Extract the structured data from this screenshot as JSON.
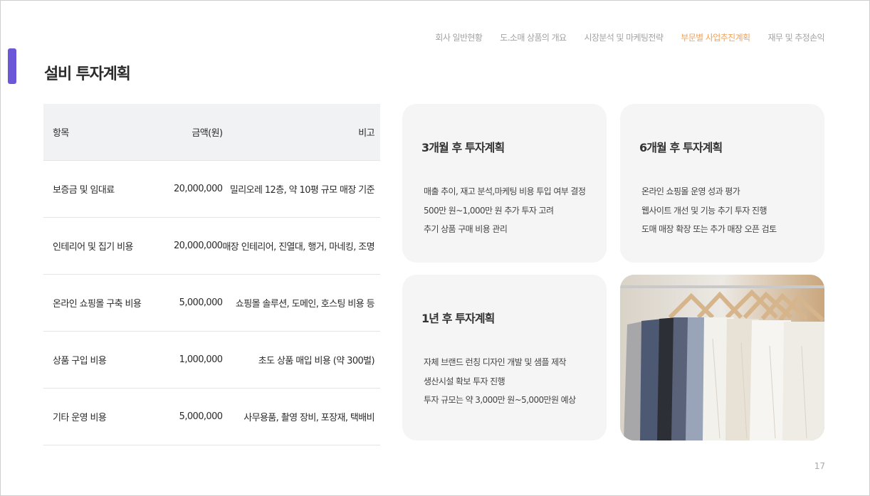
{
  "nav": {
    "items": [
      {
        "label": "회사 일반현황",
        "active": false
      },
      {
        "label": "도.소매 상품의 개요",
        "active": false
      },
      {
        "label": "시장분석 및 마케팅전략",
        "active": false
      },
      {
        "label": "부문별 사업추진계획",
        "active": true
      },
      {
        "label": "재무 및 추정손익",
        "active": false
      }
    ]
  },
  "page": {
    "title": "설비 투자계획",
    "number": "17"
  },
  "table": {
    "headers": [
      "항목",
      "금액(원)",
      "비고"
    ],
    "rows": [
      [
        "보증금 및 임대료",
        "20,000,000",
        "밀리오레 12층, 약 10평 규모 매장 기준"
      ],
      [
        "인테리어 및 집기 비용",
        "20,000,000",
        "매장 인테리어, 진열대, 행거, 마네킹, 조명"
      ],
      [
        "온라인 쇼핑몰 구축 비용",
        "5,000,000",
        "쇼핑몰 솔루션, 도메인, 호스팅 비용 등"
      ],
      [
        "상품 구입 비용",
        "1,000,000",
        "초도 상품 매입 비용 (약 300벌)"
      ],
      [
        "기타 운영 비용",
        "5,000,000",
        "사무용품, 촬영 장비, 포장재, 택배비"
      ]
    ]
  },
  "cards": {
    "three_months": {
      "title": "3개월 후 투자계획",
      "items": [
        "매출 추이, 재고 분석,마케팅 비용 투입 여부 결정",
        " 500만 원~1,000만 원 추가 투자 고려",
        "추기 상품 구매 비용 관리"
      ]
    },
    "six_months": {
      "title": "6개월 후 투자계획",
      "items": [
        "온라인 쇼핑몰 운영 성과 평가",
        "웹사이트 개선 및 기능 추기 투자 진행",
        "도매 매장 확장 또는 추가 매장 오픈 검토"
      ]
    },
    "one_year": {
      "title": "1년 후 투자계획",
      "items": [
        "자체 브랜드 런칭 디자인 개발 및 샘플 제작",
        "생산시설 확보 투자 진행",
        "투자 규모는 약 3,000만 원~5,000만원 예상"
      ]
    }
  },
  "colors": {
    "accent": "#6c57d8",
    "nav_active": "#f0a35a",
    "nav_inactive": "#a3a3a3",
    "table_header_bg": "#f1f2f4",
    "card_bg": "#f5f5f6"
  }
}
